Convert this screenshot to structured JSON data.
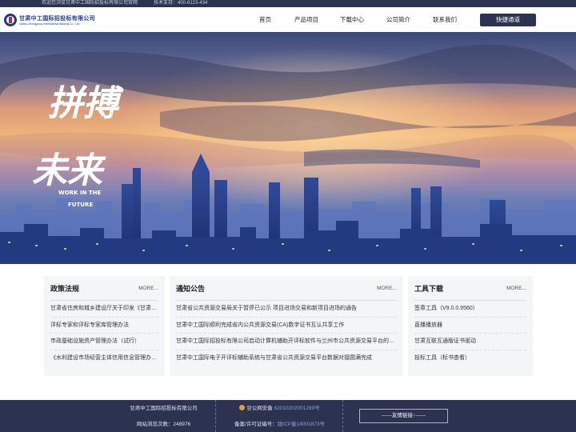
{
  "topbar": {
    "welcome": "欢迎您浏览甘肃中工国际招投标有限公司官网",
    "support": "技术支持：400-6123-434"
  },
  "logo": {
    "cn": "甘肃中工国际招投标有限公司",
    "en": "Gansu Zhonggong International Bidding Co., Ltd."
  },
  "nav": {
    "items": [
      "首页",
      "产品项目",
      "下载中心",
      "公司简介",
      "联系我们"
    ],
    "quick_label": "快捷通道"
  },
  "banner": {
    "slogan_lines": [
      "拼搏",
      "未来"
    ],
    "slogan_en_1": "WORK IN THE",
    "slogan_en_2": "FUTURE"
  },
  "panels": {
    "policy": {
      "title": "政策法规",
      "more": "MORE...",
      "items": [
        "甘肃省住房和城乡建设厅关于印发《甘肃省建设工程招标投标管理办法》的通知",
        "评标专家和评标专家库管理办法",
        "市政基础设施资产管理办法（试行）",
        "《水利建设市场经营主体信用信息管理办法》"
      ]
    },
    "notice": {
      "title": "通知公告",
      "more": "MORE...",
      "items": [
        "甘肃省公共资源交易局关于暂停已公示 项目进场交易和新项目进场的通告",
        "甘肃中工国际顺利完成省内公共资源交易(CA)数字证书互认共享工作",
        "甘肃中工国际招投标有限公司启动计算机辅助开评标软件与兰州市公共资源交易平台的数据对接",
        "甘肃中工国际电子开评标辅助系统与甘肃省公共资源交易平台数据对接圆满完成"
      ]
    },
    "tools": {
      "title": "工具下载",
      "more": "MORE...",
      "items": [
        "签章工具（V9.0.0.9560）",
        "直播播放器",
        "甘肃互联互通版证书驱动",
        "投标工具（标书查看）"
      ]
    }
  },
  "footer": {
    "company": "甘肃中工国际招投标有限公司",
    "visits_label": "网站浏览次数：",
    "visits": "248976",
    "police_label": "甘公网安备",
    "police_no": "62010202001289号",
    "icp_label": "备案/许可证编号：",
    "icp_no": "陇ICP备18001873号",
    "friends": "------友情链接↑------"
  },
  "colors": {
    "primary": "#2b3350",
    "logo_blue": "#1f3a8a",
    "logo_red": "#c8242d",
    "link": "#8f9ed6"
  }
}
